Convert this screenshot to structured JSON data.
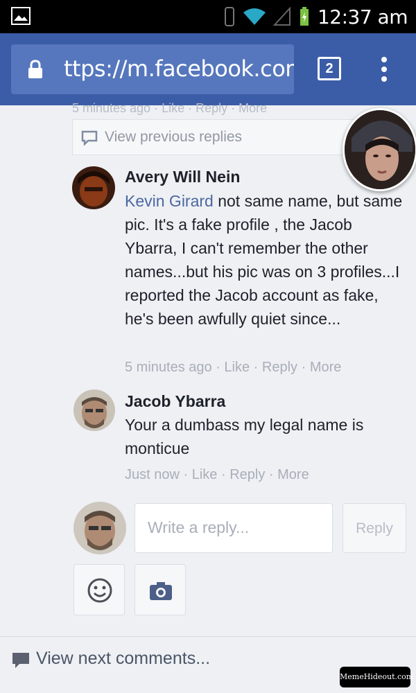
{
  "status_bar": {
    "time": "12:37 am"
  },
  "browser": {
    "url": "ttps://m.facebook.com/(",
    "tab_count": "2"
  },
  "partial_meta": "5 minutes ago · Like · Reply · More",
  "view_previous": "View previous replies",
  "comments": [
    {
      "author": "Avery Will Nein",
      "mention": "Kevin Girard",
      "text": " not same name, but same pic. It's a fake profile , the Jacob Ybarra, I can't remember the other names...but his pic was on 3 profiles...I reported the Jacob account as fake, he's been awfully quiet since...",
      "time": "5 minutes ago",
      "like": "Like",
      "reply": "Reply",
      "more": "More"
    },
    {
      "author": "Jacob Ybarra",
      "text": "Your a dumbass my legal name is monticue",
      "time": "Just now",
      "like": "Like",
      "reply": "Reply",
      "more": "More"
    }
  ],
  "reply_box": {
    "placeholder": "Write a reply...",
    "button": "Reply"
  },
  "view_next": "View next comments...",
  "watermark": "MemeHideout.com",
  "colors": {
    "facebook_blue": "#3b5da8",
    "link": "#4b67a1"
  }
}
